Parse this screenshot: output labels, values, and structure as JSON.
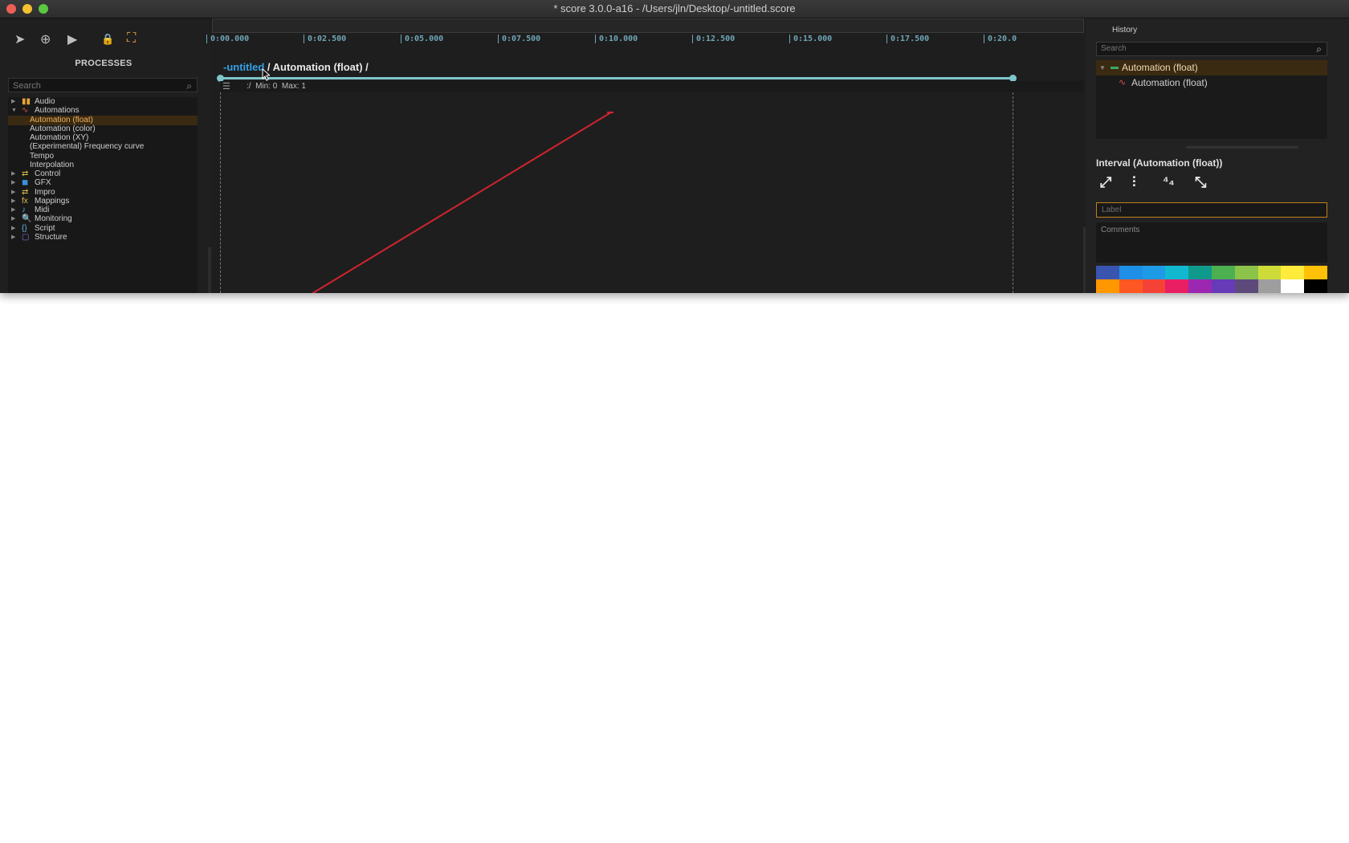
{
  "window": {
    "title": "* score 3.0.0-a16 - /Users/jln/Desktop/-untitled.score",
    "traffic_lights": [
      "#ec5f57",
      "#f5bf2f",
      "#5ac840"
    ]
  },
  "toolbar": {
    "icons": [
      "select-arrow-icon",
      "create-plus-icon",
      "play-icon",
      "lock-icon",
      "frame-icon"
    ],
    "select_glyph": "➤",
    "create_glyph": "⊕",
    "play_glyph": "▶",
    "lock_glyph": "🔒",
    "frame_glyph": "⛶"
  },
  "processes": {
    "title": "PROCESSES",
    "search_placeholder": "Search",
    "items": [
      {
        "label": "Audio",
        "icon": "audio-icon",
        "icon_glyph": "▮▮",
        "icon_color": "#e8a33a",
        "expanded": false
      },
      {
        "label": "Automations",
        "icon": "automation-icon",
        "icon_glyph": "∿",
        "icon_color": "#e05050",
        "expanded": true
      },
      {
        "label": "Automation (float)",
        "child": true,
        "selected": true
      },
      {
        "label": "Automation (color)",
        "child": true
      },
      {
        "label": "Automation (XY)",
        "child": true
      },
      {
        "label": "(Experimental) Frequency curve",
        "child": true
      },
      {
        "label": "Tempo",
        "child": true
      },
      {
        "label": "Interpolation",
        "child": true
      },
      {
        "label": "Control",
        "icon": "control-icon",
        "icon_glyph": "⇄",
        "icon_color": "#d9c04a",
        "expanded": false
      },
      {
        "label": "GFX",
        "icon": "gfx-icon",
        "icon_glyph": "◼",
        "icon_color": "#3a8fd9",
        "expanded": false
      },
      {
        "label": "Impro",
        "icon": "impro-icon",
        "icon_glyph": "⇄",
        "icon_color": "#d9c04a",
        "expanded": false
      },
      {
        "label": "Mappings",
        "icon": "mappings-icon",
        "icon_glyph": "fx",
        "icon_color": "#d9c04a",
        "expanded": false
      },
      {
        "label": "Midi",
        "icon": "midi-icon",
        "icon_glyph": "♪",
        "icon_color": "#5ab0e0",
        "expanded": false
      },
      {
        "label": "Monitoring",
        "icon": "monitoring-icon",
        "icon_glyph": "🔍",
        "icon_color": "#e05050",
        "expanded": false
      },
      {
        "label": "Script",
        "icon": "script-icon",
        "icon_glyph": "{}",
        "icon_color": "#6ab0e0",
        "expanded": false
      },
      {
        "label": "Structure",
        "icon": "structure-icon",
        "icon_glyph": "▢",
        "icon_color": "#8a6ad9",
        "expanded": false
      }
    ]
  },
  "ruler": {
    "ticks": [
      "0:00.000",
      "0:02.500",
      "0:05.000",
      "0:07.500",
      "0:10.000",
      "0:12.500",
      "0:15.000",
      "0:17.500",
      "0:20.0"
    ]
  },
  "breadcrumb": {
    "link": "-untitled",
    "rest": " / Automation (float) /"
  },
  "automation": {
    "header_prefix": ":/",
    "min_label": "Min: 0",
    "max_label": "Max: 1",
    "curve_color": "#d0242e",
    "line_color": "#7fc6cc"
  },
  "history": {
    "title": "History",
    "search_placeholder": "Search",
    "items": [
      {
        "label": "Automation (float)",
        "selected": true,
        "icon_color": "#3aa86b"
      },
      {
        "label": "Automation (float)",
        "selected": false,
        "icon_color": "#e05050"
      }
    ]
  },
  "inspector": {
    "title": "Interval (Automation (float))",
    "buttons": [
      "expand-icon",
      "mixer-icon",
      "time-signature-icon",
      "fullview-icon"
    ],
    "expand_glyph": "⤢",
    "mixer_glyph": "⫶",
    "time_sig_glyph": "⁴₄",
    "fullview_glyph": "⤡",
    "label_placeholder": "Label",
    "comments_placeholder": "Comments"
  },
  "palette": {
    "row1": [
      "#3a55b0",
      "#1e8fe6",
      "#1e9be6",
      "#12b8d0",
      "#0f9a8c",
      "#4caf50",
      "#8bc34a",
      "#cddc39",
      "#ffeb3b",
      "#ffc107"
    ],
    "row2": [
      "#ff9800",
      "#ff5722",
      "#f44336",
      "#e91e63",
      "#9c27b0",
      "#673ab7",
      "#5d4a7a",
      "#9e9e9e",
      "#ffffff",
      "#000000"
    ]
  }
}
